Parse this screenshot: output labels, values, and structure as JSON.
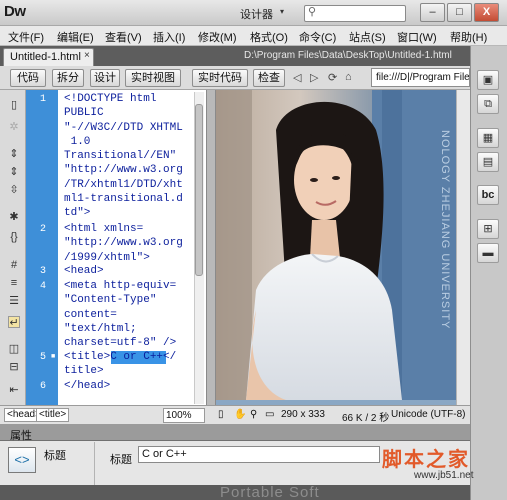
{
  "app": {
    "logo": "Dw",
    "workspace": "设计器",
    "window_min": "–",
    "window_max": "□",
    "window_close": "X"
  },
  "menu": [
    "文件(F)",
    "编辑(E)",
    "查看(V)",
    "插入(I)",
    "修改(M)",
    "格式(O)",
    "命令(C)",
    "站点(S)",
    "窗口(W)",
    "帮助(H)"
  ],
  "tabs": {
    "doc_tab_label": "Untitled-1.html",
    "doc_tab_close": "×",
    "path": "D:\\Program Files\\Data\\DeskTop\\Untitled-1.html",
    "close_glyph": "ᐯ"
  },
  "toolbar": {
    "code": "代码",
    "split": "拆分",
    "design": "设计",
    "live_view": "实时视图",
    "live_code": "实时代码",
    "inspect": "检查",
    "address": "file:///D|/Program Files/"
  },
  "code_lines": [
    {
      "num": "1",
      "lines": [
        "<!DOCTYPE html",
        "PUBLIC",
        "\"-//W3C//DTD XHTML",
        " 1.0",
        "Transitional//EN\"",
        "\"http://www.w3.org",
        "/TR/xhtml1/DTD/xht",
        "ml1-transitional.d",
        "td\">"
      ]
    },
    {
      "num": "2",
      "lines": [
        "<html xmlns=",
        "\"http://www.w3.org",
        "/1999/xhtml\">"
      ]
    },
    {
      "num": "3",
      "lines": [
        "<head>"
      ]
    },
    {
      "num": "4",
      "lines": [
        "<meta http-equiv=",
        "\"Content-Type\"",
        "content=",
        "\"text/html;",
        "charset=utf-8\" />"
      ]
    },
    {
      "num": "5",
      "lines": [
        "<title>C or C++</",
        "title>"
      ]
    },
    {
      "num": "6",
      "lines": [
        "</head>"
      ]
    }
  ],
  "photo_caption": "NOLOGY ZHEJIANG UNIVERSITY",
  "status": {
    "tag_head": "<head>",
    "tag_title": "<title>",
    "zoom": "100%",
    "dimensions": "290 x 333",
    "size": "66 K / 2 秒",
    "encoding": "Unicode (UTF-8)"
  },
  "properties": {
    "header": "属性",
    "section_label": "标题",
    "title_label": "标题",
    "title_value": "C or C++",
    "html_badge": "<>"
  },
  "bottom_brand": "Portable Soft",
  "watermark": {
    "main": "脚本之家",
    "sub": "www.jb51.net"
  },
  "colors": {
    "line_number_bg": "#3e8fd8",
    "selection": "#3993e6",
    "code_text": "#0b1e9c",
    "watermark": "#e25a2a"
  }
}
